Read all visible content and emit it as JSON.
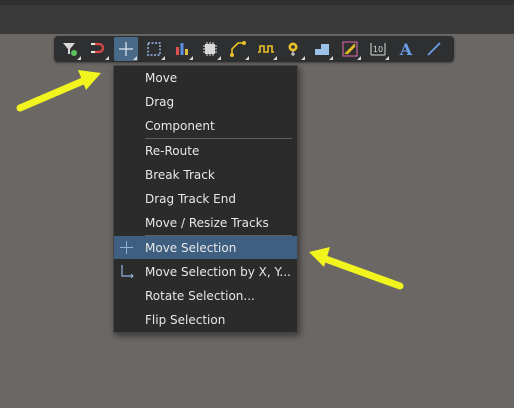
{
  "colors": {
    "canvas": "#6b6765",
    "menu_bg": "#2b2b2b",
    "selected_bg": "#3e5f80",
    "annotation_arrow": "#f2f51d"
  },
  "toolbar": {
    "buttons": [
      {
        "icon": "filter-icon"
      },
      {
        "icon": "snap-magnet-icon"
      },
      {
        "icon": "move-cross-icon",
        "active": true
      },
      {
        "icon": "select-rectangle-icon"
      },
      {
        "icon": "bar-chart-icon"
      },
      {
        "icon": "component-chip-icon"
      },
      {
        "icon": "route-track-icon"
      },
      {
        "icon": "interactive-length-tuning-icon"
      },
      {
        "icon": "via-place-icon"
      },
      {
        "icon": "polygon-pour-icon"
      },
      {
        "icon": "diff-pair-icon"
      },
      {
        "icon": "dimension-icon"
      },
      {
        "icon": "text-icon"
      },
      {
        "icon": "line-icon"
      }
    ],
    "text_glyph": "A",
    "dimension_glyph": "10"
  },
  "menu": {
    "items": [
      {
        "label": "Move"
      },
      {
        "label": "Drag"
      },
      {
        "label": "Component"
      },
      {
        "label": "Re-Route"
      },
      {
        "label": "Break Track"
      },
      {
        "label": "Drag Track End"
      },
      {
        "label": "Move / Resize Tracks"
      },
      {
        "label": "Move Selection",
        "selected": true,
        "icon": "move-cross-icon"
      },
      {
        "label": "Move Selection by X, Y...",
        "icon": "xy-axes-icon"
      },
      {
        "label": "Rotate Selection..."
      },
      {
        "label": "Flip Selection"
      }
    ]
  }
}
